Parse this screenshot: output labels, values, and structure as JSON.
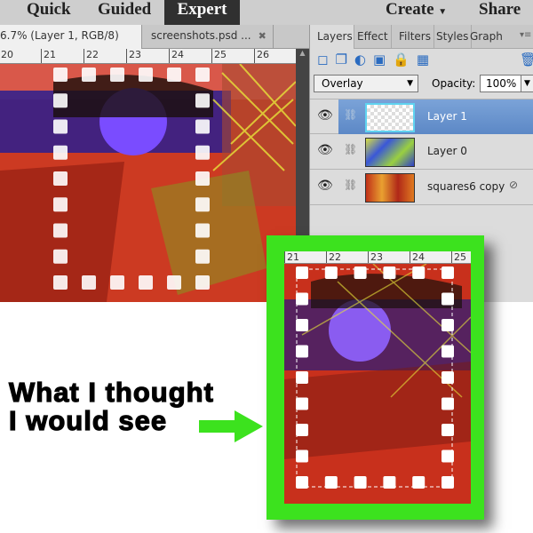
{
  "menubar": {
    "modes": [
      "Quick",
      "Guided",
      "Expert"
    ],
    "active": "Expert",
    "create": "Create",
    "share": "Share"
  },
  "doc_tabs": [
    {
      "label": "6.7% (Layer 1, RGB/8) *"
    },
    {
      "label": "screenshots.psd ..."
    }
  ],
  "ruler": [
    "20",
    "21",
    "22",
    "23",
    "24",
    "25",
    "26"
  ],
  "panel": {
    "tabs": [
      "Layers",
      "Effect",
      "Filters",
      "Styles",
      "Graph"
    ],
    "active_tab": "Layers",
    "blend_mode": "Overlay",
    "opacity_label": "Opacity:",
    "opacity_value": "100%",
    "layers": [
      {
        "name": "Layer 1",
        "selected": true
      },
      {
        "name": "Layer 0",
        "selected": false
      },
      {
        "name": "squares6 copy",
        "selected": false
      }
    ]
  },
  "inset": {
    "ruler": [
      "21",
      "22",
      "23",
      "24",
      "25"
    ],
    "frame_color": "#3ce21e"
  },
  "caption": {
    "line1": "What I thought",
    "line2": "I would see"
  },
  "colors": {
    "accent": "#3ce21e",
    "selected_layer": "#6a94cf"
  }
}
